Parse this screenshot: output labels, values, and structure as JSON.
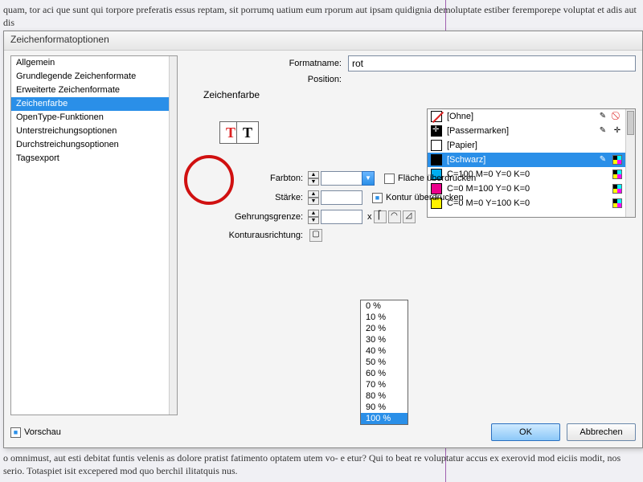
{
  "bg_top": "quam, tor aci que sunt qui torpore preferatis essus reptam, sit porrumq uatium eum\nrporum aut ipsam quidignia demoluptate estiber feremporepe voluptat et adis aut dis",
  "bg_bottom": "o omnimust, aut esti debitat funtis velenis as dolore pratist fatimento optatem utem vo-\ne etur? Qui to beat re voluptatur accus ex exerovid mod eiciis modit, nos serio. Totaspiet\nisit excepered mod quo berchil ilitatquis nus.",
  "dialog": {
    "title": "Zeichenformatoptionen"
  },
  "categories": [
    "Allgemein",
    "Grundlegende Zeichenformate",
    "Erweiterte Zeichenformate",
    "Zeichenfarbe",
    "OpenType-Funktionen",
    "Unterstreichungsoptionen",
    "Durchstreichungsoptionen",
    "Tagsexport"
  ],
  "selected_category": 3,
  "formatname_label": "Formatname:",
  "formatname_value": "rot",
  "position_label": "Position:",
  "section_title": "Zeichenfarbe",
  "swatches": [
    {
      "name": "[Ohne]",
      "chip": "none",
      "icons": [
        "pencil",
        "redslash"
      ]
    },
    {
      "name": "[Passermarken]",
      "chip": "reg",
      "icons": [
        "pencil",
        "reg-i"
      ]
    },
    {
      "name": "[Papier]",
      "chip": "#ffffff",
      "icons": []
    },
    {
      "name": "[Schwarz]",
      "chip": "#000000",
      "icons": [
        "pencil",
        "cmyk"
      ],
      "sel": true
    },
    {
      "name": "C=100 M=0 Y=0 K=0",
      "chip": "#00aeef",
      "icons": [
        "grid",
        "cmyk"
      ]
    },
    {
      "name": "C=0 M=100 Y=0 K=0",
      "chip": "#ec008c",
      "icons": [
        "grid",
        "cmyk"
      ]
    },
    {
      "name": "C=0 M=0 Y=100 K=0",
      "chip": "#fff200",
      "icons": [
        "grid",
        "cmyk"
      ]
    }
  ],
  "labels": {
    "farbton": "Farbton:",
    "staerke": "Stärke:",
    "gehrung": "Gehrungsgrenze:",
    "kontur": "Konturausrichtung:",
    "flaeche": "Fläche überdrucken",
    "konturcb": "Kontur überdrucken",
    "x": "x"
  },
  "dropdown": {
    "items": [
      "0 %",
      "10 %",
      "20 %",
      "30 %",
      "40 %",
      "50 %",
      "60 %",
      "70 %",
      "80 %",
      "90 %",
      "100 %"
    ],
    "selected": 10
  },
  "footer": {
    "preview": "Vorschau",
    "ok": "OK",
    "cancel": "Abbrechen"
  },
  "chart_data": {
    "type": "table",
    "note": "no chart present"
  }
}
